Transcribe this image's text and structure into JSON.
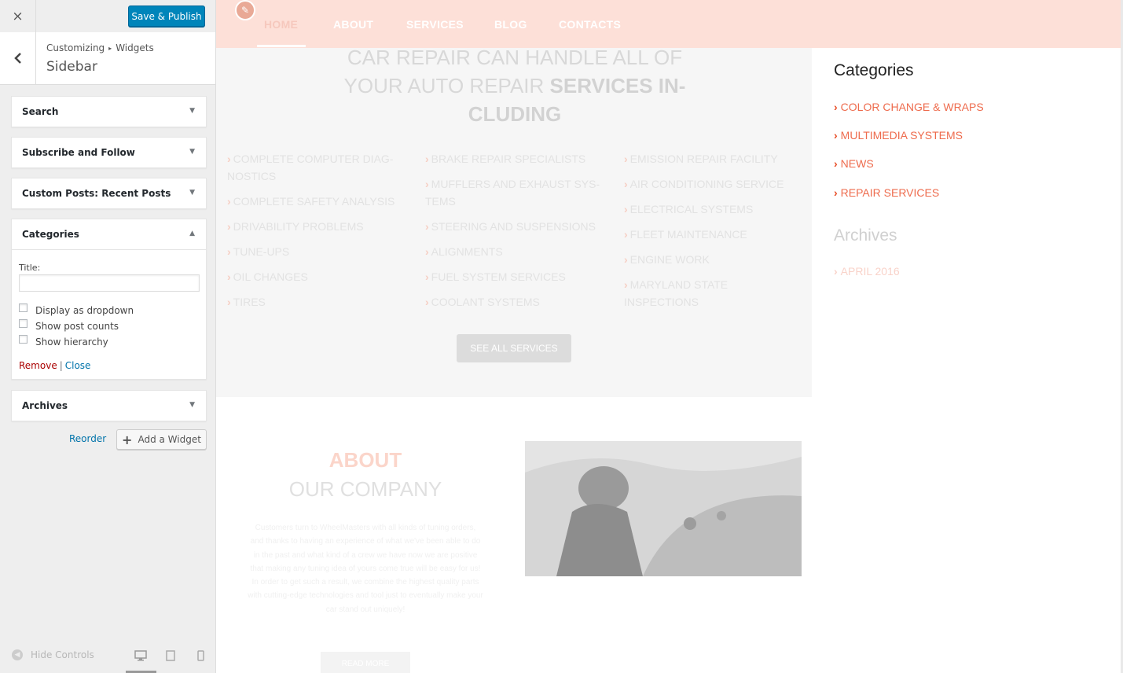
{
  "customizer": {
    "close_glyph": "×",
    "save_label": "Save & Publish",
    "breadcrumb": {
      "root": "Customizing",
      "sep": "▸",
      "leaf": "Widgets"
    },
    "section_title": "Sidebar",
    "back_glyph": "‹",
    "widgets": [
      {
        "title": "Search",
        "in_title": ""
      },
      {
        "title": "Subscribe and Follow",
        "in_title": ""
      },
      {
        "title": "Custom Posts:",
        "in_title": " Recent Posts"
      },
      {
        "title": "Categories",
        "in_title": ""
      },
      {
        "title": "Archives",
        "in_title": ""
      }
    ],
    "categories_form": {
      "title_label": "Title:",
      "title_value": "",
      "checkboxes": [
        "Display as dropdown",
        "Show post counts",
        "Show hierarchy"
      ],
      "remove_label": "Remove",
      "separator": "|",
      "close_label": "Close"
    },
    "reorder_label": "Reorder",
    "add_widget_label": "Add a Widget",
    "hide_controls_label": "Hide Controls",
    "colors": {
      "primary": "#0085ba",
      "link": "#0073aa",
      "remove": "#aa0000"
    }
  },
  "preview": {
    "nav": [
      "HOME",
      "ABOUT",
      "SERVICES",
      "BLOG",
      "CONTACTS"
    ],
    "services_heading_light": "CAR REPAIR CAN HANDLE ALL OF YOUR AUTO REPAIR",
    "services_heading_bold": "SERVICES IN­CLUDING",
    "services_col1": [
      "COMPLETE COMPUTER DIAG­NOSTICS",
      "COMPLETE SAFETY ANALYSIS",
      "DRIVABILITY PROBLEMS",
      "TUNE-UPS",
      "OIL CHANGES",
      "TIRES"
    ],
    "services_col2": [
      "BRAKE REPAIR SPECIALISTS",
      "MUFFLERS AND EXHAUST SYS­TEMS",
      "STEERING AND SUSPENSIONS",
      "ALIGNMENTS",
      "FUEL SYSTEM SERVICES",
      "COOLANT SYSTEMS"
    ],
    "services_col3": [
      "EMISSION REPAIR FACILITY",
      "AIR CONDITIONING SERVICE",
      "ELECTRICAL SYSTEMS",
      "FLEET MAINTENANCE",
      "ENGINE WORK",
      "MARYLAND STATE INSPECTIONS"
    ],
    "see_all_label": "SEE ALL SERVICES",
    "about_title": "ABOUT",
    "about_subtitle": "OUR COMPANY",
    "about_text": "Customers turn to WheelMasters with all kinds of tun­ing orders, and thanks to having an experience of what we've been able to do in the past and what kind of a crew we have now we are positive that making any tun­ing idea of yours come true will be easy for us! In order to get such a result, we combine the highest quality parts with cutting-edge technologies and tool just to eventually make your car stand out uniquely!",
    "read_more_label": "READ MORE",
    "sidebar_categories_heading": "Categories",
    "categories": [
      "COLOR CHANGE & WRAPS",
      "MULTIMEDIA SYSTEMS",
      "NEWS",
      "REPAIR SERVICES"
    ],
    "sidebar_archives_heading": "Archives",
    "archives": [
      "APRIL 2016"
    ],
    "colors": {
      "accent": "#e84e28",
      "nav_bg": "#fde0d8"
    }
  }
}
